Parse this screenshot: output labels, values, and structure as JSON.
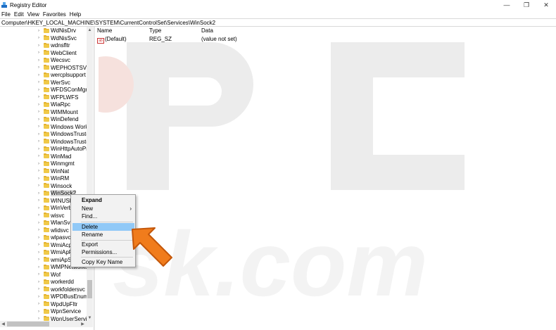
{
  "window": {
    "title": "Registry Editor",
    "controls": {
      "minimize": "—",
      "maximize": "❐",
      "close": "✕"
    }
  },
  "menubar": [
    "File",
    "Edit",
    "View",
    "Favorites",
    "Help"
  ],
  "address": "Computer\\HKEY_LOCAL_MACHINE\\SYSTEM\\CurrentControlSet\\Services\\WinSock2",
  "tree": {
    "items": [
      "WdNisDrv",
      "WdNisSvc",
      "wdnsfltr",
      "WebClient",
      "Wecsvc",
      "WEPHOSTSVC",
      "wercplsupport",
      "WerSvc",
      "WFDSConMgrS",
      "WFPLWFS",
      "WiaRpc",
      "WIMMount",
      "WinDefend",
      "Windows Work",
      "WindowsTruste",
      "WindowsTruste",
      "WinHttpAutoPr",
      "WinMad",
      "Winmgmt",
      "WinNat",
      "WinRM",
      "Winsock",
      "WinSock2",
      "WINUSB",
      "WinVerb",
      "wisvc",
      "WlanSvc",
      "wlidsvc",
      "wlpasvc",
      "WmiAcp",
      "WmiApRpl",
      "wmiApSrv",
      "WMPNetworkS",
      "Wof",
      "workerdd",
      "workfoldersvc",
      "WPDBusEnum",
      "WpdUpFltr",
      "WpnService",
      "WpnUserServic"
    ],
    "selected_index": 22
  },
  "list": {
    "headers": {
      "name": "Name",
      "type": "Type",
      "data": "Data"
    },
    "rows": [
      {
        "name": "(Default)",
        "type": "REG_SZ",
        "data": "(value not set)",
        "icon": "ab"
      }
    ]
  },
  "context_menu": {
    "items": [
      {
        "label": "Expand",
        "bold": true
      },
      {
        "label": "New",
        "submenu": "›"
      },
      {
        "label": "Find..."
      },
      {
        "label": "Delete",
        "highlighted": true
      },
      {
        "label": "Rename"
      },
      {
        "label": "Export"
      },
      {
        "label": "Permissions..."
      },
      {
        "label": "Copy Key Name"
      }
    ]
  },
  "colors": {
    "highlight": "#91c9f7",
    "pointer_arrow": "#f07c1c",
    "watermark": "#e8e8e8",
    "watermark_accent": "#f7d9d5"
  },
  "icons": {
    "app": "registry-cube-icon",
    "folder": "folder-icon",
    "value": "string-value-icon",
    "pointer": "orange-arrow-icon"
  }
}
